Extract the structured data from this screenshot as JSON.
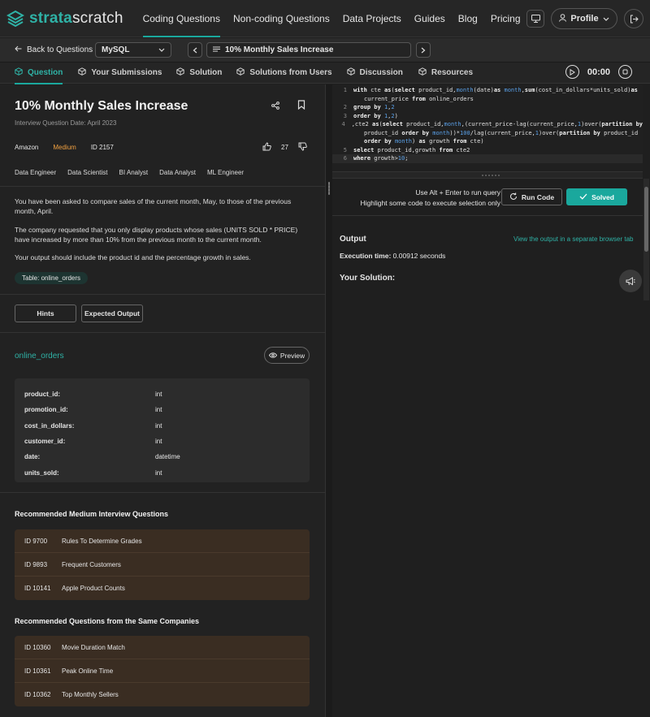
{
  "brand": {
    "part1": "strata",
    "part2": "scratch"
  },
  "nav": [
    "Coding Questions",
    "Non-coding Questions",
    "Data Projects",
    "Guides",
    "Blog",
    "Pricing"
  ],
  "profile_label": "Profile",
  "back_label": "Back to Questions",
  "dialect": "MySQL",
  "question_title_box": "10% Monthly Sales Increase",
  "tabs": [
    "Question",
    "Your Submissions",
    "Solution",
    "Solutions from Users",
    "Discussion",
    "Resources"
  ],
  "timer": "00:00",
  "question": {
    "title": "10% Monthly Sales Increase",
    "date": "Interview Question Date: April 2023",
    "company": "Amazon",
    "difficulty": "Medium",
    "id": "ID 2157",
    "votes": "27",
    "tags": [
      "Data Engineer",
      "Data Scientist",
      "BI Analyst",
      "Data Analyst",
      "ML Engineer"
    ],
    "desc1": "You have been asked to compare sales of the current month, May, to those of the previous month, April.",
    "desc2": "The company requested that you only display products whose sales (UNITS SOLD * PRICE) have increased by more than 10% from the previous month to the current month.",
    "desc3": "Your output should include the product id and the percentage growth in sales.",
    "table_badge": "Table: online_orders"
  },
  "hints_label": "Hints",
  "expected_label": "Expected Output",
  "dataset": {
    "name": "online_orders",
    "preview_label": "Preview",
    "columns": [
      {
        "name": "product_id:",
        "type": "int"
      },
      {
        "name": "promotion_id:",
        "type": "int"
      },
      {
        "name": "cost_in_dollars:",
        "type": "int"
      },
      {
        "name": "customer_id:",
        "type": "int"
      },
      {
        "name": "date:",
        "type": "datetime"
      },
      {
        "name": "units_sold:",
        "type": "int"
      }
    ]
  },
  "rec_medium": {
    "title": "Recommended Medium Interview Questions",
    "items": [
      {
        "id": "ID 9700",
        "title": "Rules To Determine Grades"
      },
      {
        "id": "ID 9893",
        "title": "Frequent Customers"
      },
      {
        "id": "ID 10141",
        "title": "Apple Product Counts"
      }
    ]
  },
  "rec_company": {
    "title": "Recommended Questions from the Same Companies",
    "items": [
      {
        "id": "ID 10360",
        "title": "Movie Duration Match"
      },
      {
        "id": "ID 10361",
        "title": "Peak Online Time"
      },
      {
        "id": "ID 10362",
        "title": "Top Monthly Sellers"
      }
    ]
  },
  "run": {
    "hint1": "Use Alt + Enter to run query",
    "hint2": "Highlight some code to execute selection only",
    "run_label": "Run Code",
    "solved_label": "Solved"
  },
  "output": {
    "title": "Output",
    "link": "View the output in a separate browser tab",
    "exec_label": "Execution time:",
    "exec_value": "0.00912 seconds",
    "solution_title": "Your Solution:"
  },
  "colors": {
    "accent": "#1aa89d",
    "accent_text": "#2fb2a6",
    "medium": "#f0a040"
  }
}
